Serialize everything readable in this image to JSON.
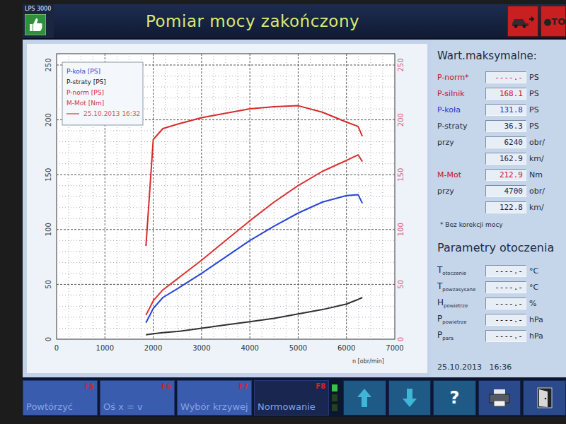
{
  "window": {
    "title": "Pomiar mocy zakończony",
    "app": "LPS 3000"
  },
  "toolbar": {
    "stop": "●TO"
  },
  "chart": {
    "y_ticks": [
      "0",
      "50",
      "100",
      "150",
      "200",
      "250"
    ],
    "y2_ticks": [
      "0",
      "50",
      "100",
      "150",
      "200",
      "250"
    ],
    "x_ticks": [
      "0",
      "1000",
      "2000",
      "3000",
      "4000",
      "5000",
      "6000",
      "7000"
    ],
    "x_label": "n [obr/min]",
    "legend": [
      {
        "label": "P-koła [PS]",
        "color": "#2a44d8",
        "kind": "text"
      },
      {
        "label": "P-straty [PS]",
        "color": "#202020",
        "kind": "text"
      },
      {
        "label": "P-norm [PS]",
        "color": "#d82a2a",
        "kind": "text"
      },
      {
        "label": "M-Mot [Nm]",
        "color": "#c84040",
        "kind": "text"
      },
      {
        "label": "25.10.2013 16:32",
        "color": "#d06060",
        "kind": "line"
      }
    ],
    "rpm": [
      1850,
      2000,
      2200,
      2500,
      3000,
      3500,
      4000,
      4500,
      5000,
      5500,
      6000,
      6240,
      6330
    ],
    "series": [
      {
        "color": "#d82a2a",
        "values": [
          85,
          182,
          192,
          196,
          202,
          206,
          210,
          212,
          212.9,
          207,
          198,
          194,
          185
        ]
      },
      {
        "color": "#e03030",
        "values": [
          22,
          35,
          45,
          55,
          72,
          90,
          108,
          125,
          140,
          153,
          163,
          168.1,
          162
        ]
      },
      {
        "color": "#2a44d8",
        "values": [
          15,
          28,
          38,
          46,
          60,
          75,
          90,
          103,
          115,
          125,
          131,
          131.8,
          124
        ]
      },
      {
        "color": "#303030",
        "values": [
          4,
          5,
          6,
          7,
          10,
          13,
          16,
          19,
          23,
          27,
          32,
          36.3,
          38
        ]
      }
    ]
  },
  "maxima": {
    "title": "Wart.maksymalne:",
    "rows": [
      {
        "label": "P-norm*",
        "value": "----.-",
        "unit": "PS",
        "color": "#c8102e"
      },
      {
        "label": "P-silnik",
        "value": "168.1",
        "unit": "PS",
        "color": "#c8102e"
      },
      {
        "label": "P-koła",
        "value": "131.8",
        "unit": "PS",
        "color": "#1f3ad0"
      },
      {
        "label": "P-straty",
        "value": "36.3",
        "unit": "PS",
        "color": "#1d2a44"
      },
      {
        "label": "przy",
        "value": "6240",
        "unit": "obr/",
        "color": "#1d2a44"
      },
      {
        "label": "",
        "value": "162.9",
        "unit": "km/",
        "color": "#1d2a44"
      },
      {
        "label": "M-Mot",
        "value": "212.9",
        "unit": "Nm",
        "color": "#c8102e"
      },
      {
        "label": "przy",
        "value": "4700",
        "unit": "obr/",
        "color": "#1d2a44"
      },
      {
        "label": "",
        "value": "122.8",
        "unit": "km/",
        "color": "#1d2a44"
      }
    ],
    "note": "* Bez korekcji mocy"
  },
  "environment": {
    "title": "Parametry otoczenia",
    "rows": [
      {
        "symbol": "T",
        "sub": "otoczenie",
        "value": "----.-",
        "unit": "°C"
      },
      {
        "symbol": "T",
        "sub": "powzasysane",
        "value": "----.-",
        "unit": "°C"
      },
      {
        "symbol": "H",
        "sub": "powietrze",
        "value": "----.-",
        "unit": "%"
      },
      {
        "symbol": "P",
        "sub": "powietrze",
        "value": "----.-",
        "unit": "hPa"
      },
      {
        "symbol": "P",
        "sub": "para",
        "value": "----.-",
        "unit": "hPa"
      }
    ]
  },
  "timestamp": "25.10.2013   16:36",
  "function_keys": [
    {
      "label": "Powtórzyć",
      "key": "F5",
      "selected": false
    },
    {
      "label": "Oś x = v",
      "key": "F6",
      "selected": false
    },
    {
      "label": "Wybór krzywej",
      "key": "F7",
      "selected": false
    },
    {
      "label": "Normowanie",
      "key": "F8",
      "selected": true
    }
  ],
  "indicator": {
    "level": 0.34
  },
  "help": "?"
}
